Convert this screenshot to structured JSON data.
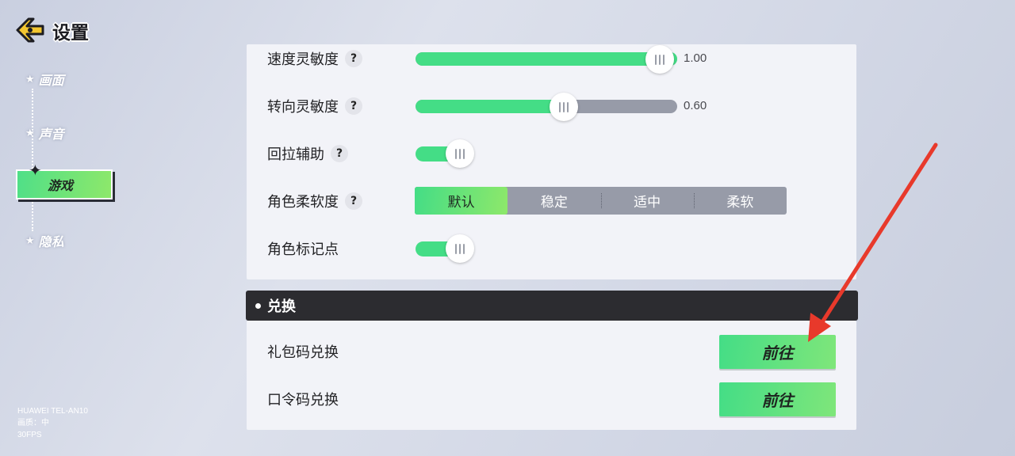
{
  "header": {
    "title": "设置"
  },
  "sidebar": {
    "items": [
      {
        "label": "画面"
      },
      {
        "label": "声音"
      },
      {
        "label": "游戏"
      },
      {
        "label": "隐私"
      }
    ],
    "active_index": 2
  },
  "device": {
    "model": "HUAWEI TEL-AN10",
    "quality": "画质：中",
    "fps": "30FPS"
  },
  "settings": {
    "speed_sensitivity": {
      "label": "速度灵敏度",
      "value_text": "1.00",
      "fill_fraction": 1.0
    },
    "turn_sensitivity": {
      "label": "转向灵敏度",
      "value_text": "0.60",
      "fill_fraction": 0.6
    },
    "pullback_assist": {
      "label": "回拉辅助",
      "on": true
    },
    "character_softness": {
      "label": "角色柔软度",
      "options": [
        "默认",
        "稳定",
        "适中",
        "柔软"
      ],
      "selected": "默认"
    },
    "character_marker": {
      "label": "角色标记点",
      "on": true
    }
  },
  "redeem": {
    "section_title": "兑换",
    "rows": [
      {
        "label": "礼包码兑换",
        "button": "前往"
      },
      {
        "label": "口令码兑换",
        "button": "前往"
      }
    ]
  },
  "colors": {
    "accent_green": "#44dd86",
    "track_gray": "#979ba8",
    "header_dark": "#2c2c30",
    "annotation_red": "#e8392b"
  }
}
